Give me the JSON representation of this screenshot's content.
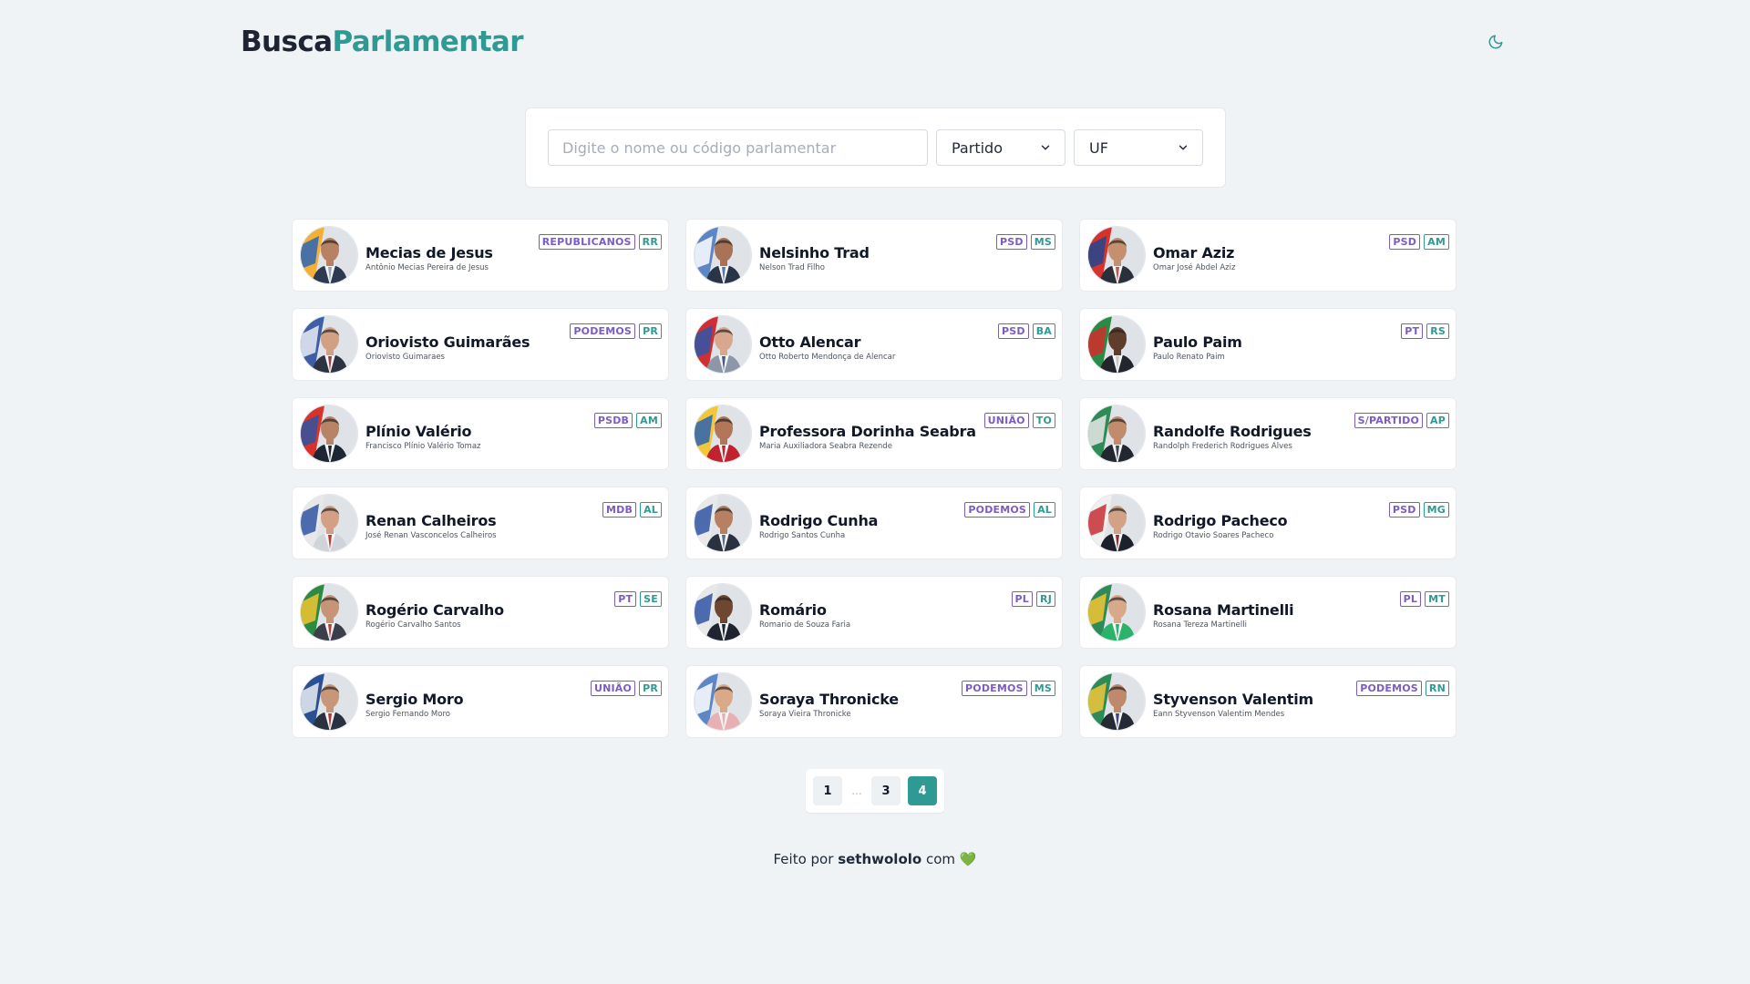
{
  "logo": {
    "part1": "Busca",
    "part2": "Parlamentar"
  },
  "search": {
    "placeholder": "Digite o nome ou código parlamentar",
    "value": ""
  },
  "filters": {
    "partido": "Partido",
    "uf": "UF"
  },
  "colors": {
    "accent": "#2f9a93",
    "party_tag": "#7c5cc4",
    "background": "#f0f3f6"
  },
  "senators": [
    {
      "name": "Mecias de Jesus",
      "fullname": "Antônio Mecias Pereira de Jesus",
      "party": "REPUBLICANOS",
      "uf": "RR",
      "skin": "#b98163",
      "suit": "#2d3a52",
      "tie": "#9aa4b8",
      "flag1": "#f2b035",
      "flag2": "#2c66b8"
    },
    {
      "name": "Nelsinho Trad",
      "fullname": "Nelson Trad Filho",
      "party": "PSD",
      "uf": "MS",
      "skin": "#a97358",
      "suit": "#2a3447",
      "tie": "#5a78a8",
      "flag1": "#5d86c4",
      "flag2": "#ffffff"
    },
    {
      "name": "Omar Aziz",
      "fullname": "Omar José Abdel Aziz",
      "party": "PSD",
      "uf": "AM",
      "skin": "#c49070",
      "suit": "#2b2f3a",
      "tie": "#c1534b",
      "flag1": "#d8322c",
      "flag2": "#22458f"
    },
    {
      "name": "Oriovisto Guimarães",
      "fullname": "Oriovisto Guimaraes",
      "party": "PODEMOS",
      "uf": "PR",
      "skin": "#d2a184",
      "suit": "#2d3340",
      "tie": "#9c3d46",
      "flag1": "#3d5fa5",
      "flag2": "#e9edf3"
    },
    {
      "name": "Otto Alencar",
      "fullname": "Otto Roberto Mendonça de Alencar",
      "party": "PSD",
      "uf": "BA",
      "skin": "#d7a88e",
      "suit": "#8e97a8",
      "tie": "#4a5b82",
      "flag1": "#cf2f33",
      "flag2": "#2d56a8"
    },
    {
      "name": "Paulo Paim",
      "fullname": "Paulo Renato Paim",
      "party": "PT",
      "uf": "RS",
      "skin": "#5f3d2c",
      "suit": "#22252c",
      "tie": "#c8c8c8",
      "flag1": "#2a8a46",
      "flag2": "#d52b2b"
    },
    {
      "name": "Plínio Valério",
      "fullname": "Francisco Plínio Valério Tomaz",
      "party": "PSDB",
      "uf": "AM",
      "skin": "#b88467",
      "suit": "#1f2633",
      "tie": "#1f2633",
      "flag1": "#d8322c",
      "flag2": "#2f55a3"
    },
    {
      "name": "Professora Dorinha Seabra",
      "fullname": "Maria Auxiliadora Seabra Rezende",
      "party": "UNIÃO",
      "uf": "TO",
      "skin": "#b37658",
      "suit": "#c0232e",
      "tie": "#c0232e",
      "flag1": "#f0c838",
      "flag2": "#2c63b5"
    },
    {
      "name": "Randolfe Rodrigues",
      "fullname": "Randolph Frederich Rodrigues Alves",
      "party": "S/PARTIDO",
      "uf": "AP",
      "skin": "#c08c6c",
      "suit": "#23272f",
      "tie": "#3d4452",
      "flag1": "#2e8b57",
      "flag2": "#e8e8e8"
    },
    {
      "name": "Renan Calheiros",
      "fullname": "José Renan Vasconcelos Calheiros",
      "party": "MDB",
      "uf": "AL",
      "skin": "#d3a085",
      "suit": "#d0d4da",
      "tie": "#b53a3a",
      "flag1": "#e8e8e8",
      "flag2": "#2f55a3"
    },
    {
      "name": "Rodrigo Cunha",
      "fullname": "Rodrigo Santos Cunha",
      "party": "PODEMOS",
      "uf": "AL",
      "skin": "#b88062",
      "suit": "#2a3140",
      "tie": "#5a6c8a",
      "flag1": "#e9e9e9",
      "flag2": "#2f55a3"
    },
    {
      "name": "Rodrigo Pacheco",
      "fullname": "Rodrigo Otavio Soares Pacheco",
      "party": "PSD",
      "uf": "MG",
      "skin": "#d1a286",
      "suit": "#1c212b",
      "tie": "#8f2f35",
      "flag1": "#f0f0f0",
      "flag2": "#c62f36"
    },
    {
      "name": "Rogério Carvalho",
      "fullname": "Rogério Carvalho Santos",
      "party": "PT",
      "uf": "SE",
      "skin": "#c69476",
      "suit": "#3a3f4b",
      "tie": "#b83d3d",
      "flag1": "#2c8a43",
      "flag2": "#f2c631"
    },
    {
      "name": "Romário",
      "fullname": "Romario de Souza Faria",
      "party": "PL",
      "uf": "RJ",
      "skin": "#6e4733",
      "suit": "#1f2430",
      "tie": "#1f2430",
      "flag1": "#e8e8e8",
      "flag2": "#2f55a3"
    },
    {
      "name": "Rosana Martinelli",
      "fullname": "Rosana Tereza Martinelli",
      "party": "PL",
      "uf": "MT",
      "skin": "#d7a989",
      "suit": "#2bb36b",
      "tie": "#2bb36b",
      "flag1": "#2e8b57",
      "flag2": "#f2c631"
    },
    {
      "name": "Sergio Moro",
      "fullname": "Sergio Fernando Moro",
      "party": "UNIÃO",
      "uf": "PR",
      "skin": "#c89679",
      "suit": "#2a3140",
      "tie": "#b0363c",
      "flag1": "#2a4f93",
      "flag2": "#e9edf3"
    },
    {
      "name": "Soraya Thronicke",
      "fullname": "Soraya Vieira Thronicke",
      "party": "PODEMOS",
      "uf": "MS",
      "skin": "#d9a98a",
      "suit": "#e7b0b4",
      "tie": "#e7b0b4",
      "flag1": "#5d86c4",
      "flag2": "#ffffff"
    },
    {
      "name": "Styvenson Valentim",
      "fullname": "Eann Styvenson Valentim Mendes",
      "party": "PODEMOS",
      "uf": "RN",
      "skin": "#bf8a6b",
      "suit": "#252a34",
      "tie": "#3c4a7a",
      "flag1": "#2e8b57",
      "flag2": "#f0c838"
    }
  ],
  "pagination": {
    "pages": [
      "1",
      "3",
      "4"
    ],
    "ellipsis": "...",
    "active": "4"
  },
  "footer": {
    "prefix": "Feito por",
    "author": "sethwololo",
    "suffix": "com",
    "heart": "💚"
  }
}
